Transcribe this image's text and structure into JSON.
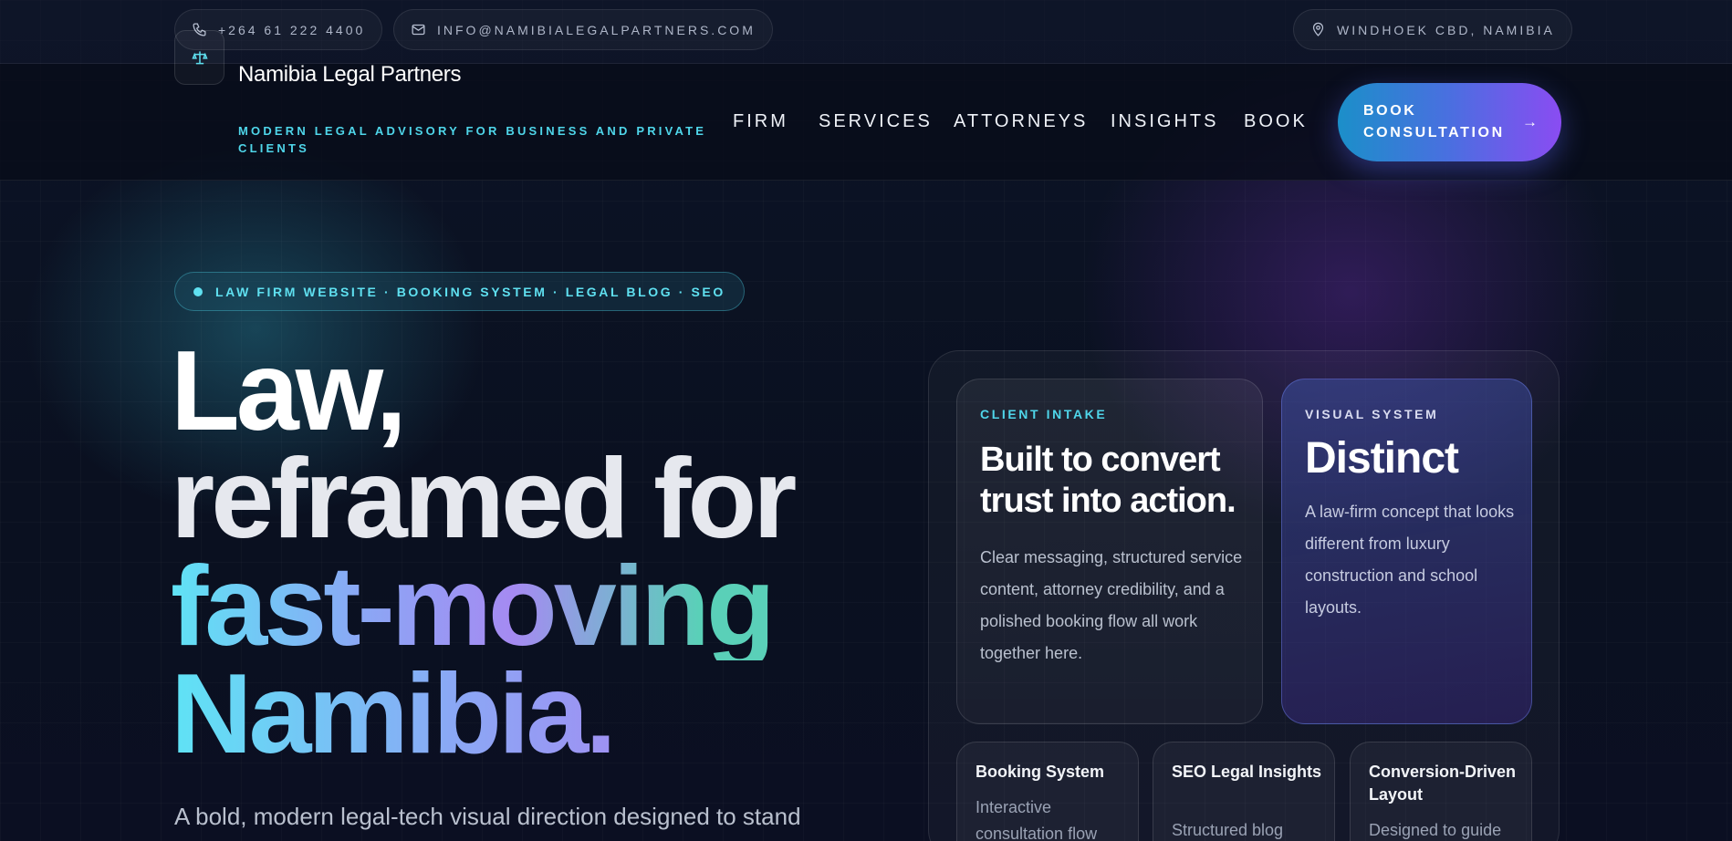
{
  "topbar": {
    "phone": "+264 61 222 4400",
    "email": "INFO@NAMIBIALEGALPARTNERS.COM",
    "location": "WINDHOEK CBD, NAMIBIA"
  },
  "brand": {
    "name": "Namibia Legal Partners",
    "tagline": "MODERN LEGAL ADVISORY FOR BUSINESS AND PRIVATE CLIENTS"
  },
  "nav": {
    "items": [
      {
        "label": "FIRM"
      },
      {
        "label": "SERVICES"
      },
      {
        "label": "ATTORNEYS"
      },
      {
        "label": "INSIGHTS"
      },
      {
        "label": "BOOK"
      }
    ],
    "cta_label": "BOOK CONSULTATION",
    "cta_arrow": "→"
  },
  "hero": {
    "badge": "LAW FIRM WEBSITE · BOOKING SYSTEM · LEGAL BLOG · SEO",
    "headline": {
      "line1": "Law,",
      "line2": "reframed for",
      "line3": "fast-moving",
      "line4": "Namibia."
    },
    "subcopy": "A bold, modern legal-tech visual direction designed to stand"
  },
  "showcase": {
    "intake": {
      "eyebrow": "CLIENT INTAKE",
      "title": "Built to convert trust into action.",
      "body": "Clear messaging, structured service content, attorney credibility, and a polished booking flow all work together here."
    },
    "visual": {
      "eyebrow": "VISUAL SYSTEM",
      "title": "Distinct",
      "body": "A law-firm concept that looks different from luxury construction and school layouts."
    },
    "features": [
      {
        "title": "Booking System",
        "body": "Interactive consultation flow"
      },
      {
        "title": "SEO Legal Insights",
        "body": "Structured blog"
      },
      {
        "title": "Conversion-Driven Layout",
        "body": "Designed to guide"
      }
    ]
  },
  "icons": {
    "phone": "phone-icon",
    "mail": "mail-icon",
    "location": "map-pin-icon",
    "logo": "scales-icon"
  }
}
